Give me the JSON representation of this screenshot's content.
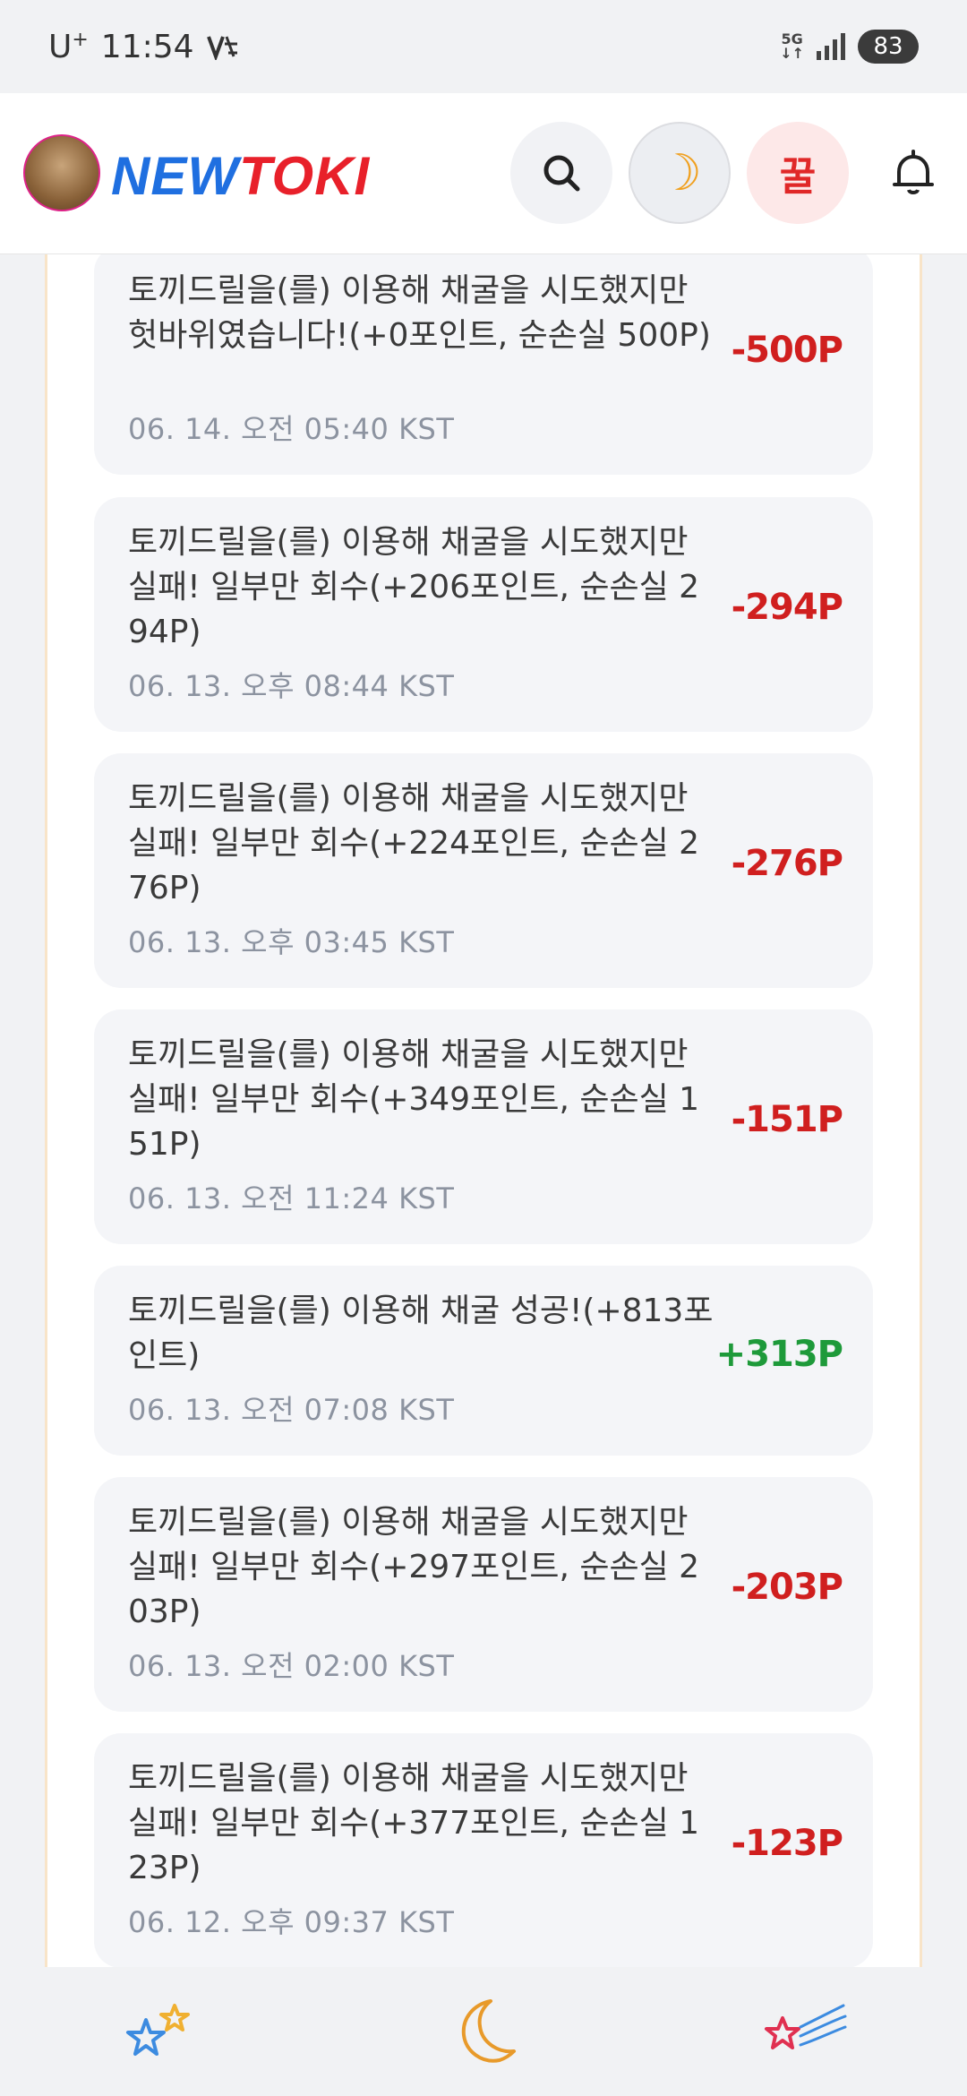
{
  "status_bar": {
    "carrier": "U",
    "carrier_sup": "+",
    "time": "11:54",
    "network": "5G",
    "battery": "83"
  },
  "header": {
    "logo_part1": "NEW",
    "logo_part2": "TOKI",
    "honey_label": "꿀",
    "moon_glyph": "☽"
  },
  "items": [
    {
      "text": "토끼드릴을(를) 이용해 채굴을 시도했지만 헛바위였습니다!(+0포인트, 순손실 500P)",
      "date": "06. 14. 오전 05:40 KST",
      "amount": "-500P",
      "kind": "neg"
    },
    {
      "text": "토끼드릴을(를) 이용해 채굴을 시도했지만 실패! 일부만 회수(+206포인트, 순손실 294P)",
      "date": "06. 13. 오후 08:44 KST",
      "amount": "-294P",
      "kind": "neg"
    },
    {
      "text": "토끼드릴을(를) 이용해 채굴을 시도했지만 실패! 일부만 회수(+224포인트, 순손실 276P)",
      "date": "06. 13. 오후 03:45 KST",
      "amount": "-276P",
      "kind": "neg"
    },
    {
      "text": "토끼드릴을(를) 이용해 채굴을 시도했지만 실패! 일부만 회수(+349포인트, 순손실 151P)",
      "date": "06. 13. 오전 11:24 KST",
      "amount": "-151P",
      "kind": "neg"
    },
    {
      "text": "토끼드릴을(를) 이용해 채굴 성공!(+813포인트)",
      "date": "06. 13. 오전 07:08 KST",
      "amount": "+313P",
      "kind": "pos"
    },
    {
      "text": "토끼드릴을(를) 이용해 채굴을 시도했지만 실패! 일부만 회수(+297포인트, 순손실 203P)",
      "date": "06. 13. 오전 02:00 KST",
      "amount": "-203P",
      "kind": "neg"
    },
    {
      "text": "토끼드릴을(를) 이용해 채굴을 시도했지만 실패! 일부만 회수(+377포인트, 순손실 123P)",
      "date": "06. 12. 오후 09:37 KST",
      "amount": "-123P",
      "kind": "neg"
    }
  ]
}
